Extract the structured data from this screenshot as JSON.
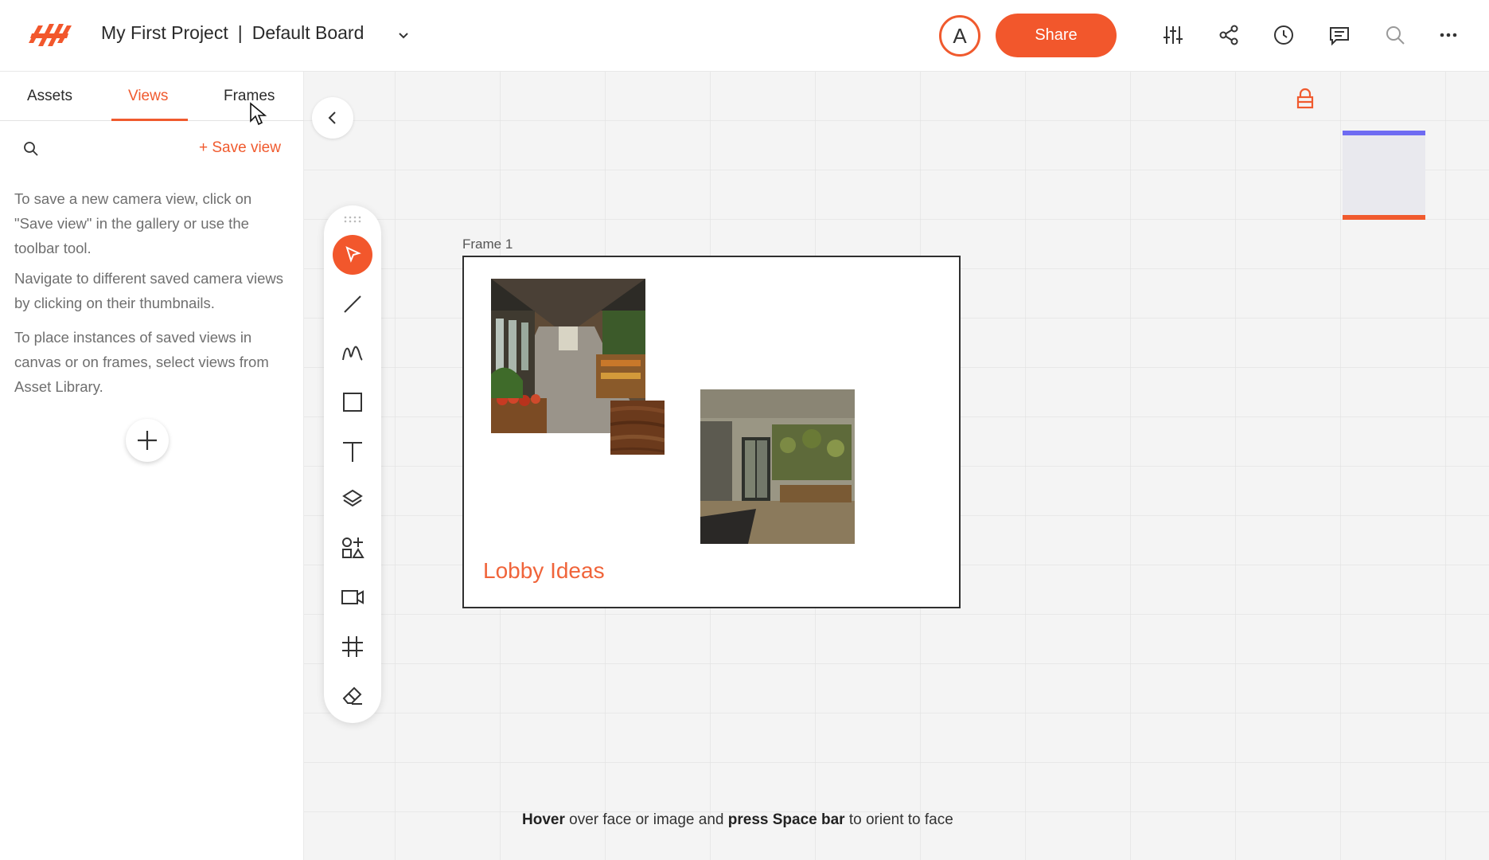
{
  "app": {
    "project_name": "My First Project",
    "separator": "|",
    "board_name": "Default Board",
    "avatar_initial": "A",
    "share_label": "Share",
    "accent_color": "#f2572c"
  },
  "topbar_icons": [
    "sliders-icon",
    "share-nodes-icon",
    "history-icon",
    "comment-icon",
    "search-icon",
    "more-icon"
  ],
  "left_panel": {
    "tabs": [
      {
        "label": "Assets",
        "active": false
      },
      {
        "label": "Views",
        "active": true
      },
      {
        "label": "Frames",
        "active": false
      }
    ],
    "save_view_label": "+ Save view",
    "help": [
      "To save a new camera view, click on \"Save view\" in the gallery or use the toolbar tool.",
      "Navigate to different saved camera views by clicking on their thumbnails.",
      "To place instances of saved views in canvas or on frames, select views from Asset Library."
    ]
  },
  "toolbar": {
    "tools": [
      "select-tool",
      "line-tool",
      "freehand-tool",
      "rectangle-tool",
      "text-tool",
      "layers-tool",
      "shapes-tool",
      "camera-tool",
      "grid-tool",
      "eraser-tool"
    ],
    "active_tool": "select-tool"
  },
  "canvas": {
    "frame_label": "Frame 1",
    "frame_title": "Lobby Ideas",
    "hint": {
      "part1": "Hover",
      "part2": " over face or image and ",
      "part3": "press Space bar",
      "part4": " to orient to face"
    }
  }
}
